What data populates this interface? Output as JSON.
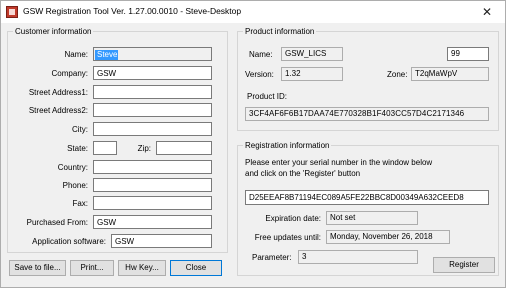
{
  "window": {
    "title": "GSW Registration Tool   Ver. 1.27.00.0010 - Steve-Desktop",
    "close_glyph": "✕"
  },
  "customer": {
    "legend": "Customer information",
    "name_label": "Name:",
    "name_value": "Steve",
    "company_label": "Company:",
    "company_value": "GSW",
    "street1_label": "Street Address1:",
    "street1_value": "",
    "street2_label": "Street Address2:",
    "street2_value": "",
    "city_label": "City:",
    "city_value": "",
    "state_label": "State:",
    "state_value": "",
    "zip_label": "Zip:",
    "zip_value": "",
    "country_label": "Country:",
    "country_value": "",
    "phone_label": "Phone:",
    "phone_value": "",
    "fax_label": "Fax:",
    "fax_value": "",
    "purchased_label": "Purchased From:",
    "purchased_value": "GSW",
    "appsoftware_label": "Application software:",
    "appsoftware_value": "GSW"
  },
  "product": {
    "legend": "Product information",
    "name_label": "Name:",
    "name_value": "GSW_LICS",
    "count_value": "99",
    "version_label": "Version:",
    "version_value": "1.32",
    "zone_label": "Zone:",
    "zone_value": "T2qMaWpV",
    "id_label": "Product ID:",
    "id_value": "3CF4AF6F6B17DAA74E770328B1F403CC57D4C2171346"
  },
  "registration": {
    "legend": "Registration information",
    "instruction": "Please enter your serial number in the window below and click on the 'Register' button",
    "serial_value": "D25EEAF8B71194EC089A5FE22BBC8D00349A632CEED8",
    "expiration_label": "Expiration date:",
    "expiration_value": "Not set",
    "updates_label": "Free updates until:",
    "updates_value": "Monday, November 26, 2018",
    "parameter_label": "Parameter:",
    "parameter_value": "3",
    "register_label": "Register"
  },
  "buttons": {
    "save_label": "Save to file...",
    "print_label": "Print...",
    "hwkey_label": "Hw Key...",
    "close_label": "Close"
  },
  "colors": {
    "selection": "#3399ff",
    "focus_border": "#0078d7",
    "dialog_bg": "#f0f0f0"
  }
}
